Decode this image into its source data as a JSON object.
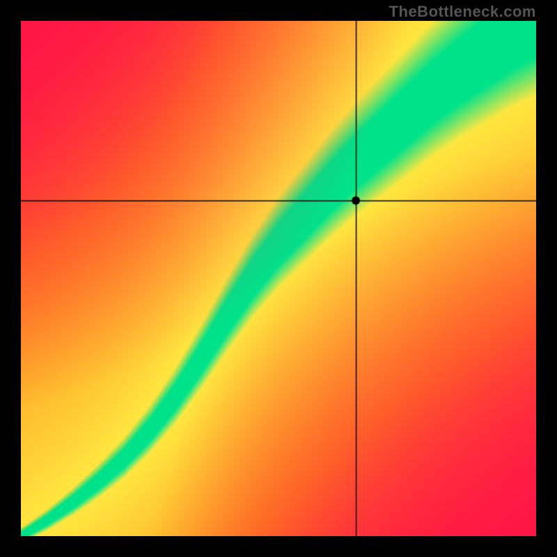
{
  "watermark": "TheBottleneck.com",
  "chart_data": {
    "type": "heatmap",
    "title": "",
    "xlabel": "",
    "ylabel": "",
    "xlim": [
      0,
      1
    ],
    "ylim": [
      0,
      1
    ],
    "crosshair": {
      "x": 0.651,
      "y": 0.651
    },
    "marker": {
      "x": 0.651,
      "y": 0.651
    },
    "green_curve": [
      {
        "x": 0.0,
        "y": 0.0
      },
      {
        "x": 0.05,
        "y": 0.03
      },
      {
        "x": 0.1,
        "y": 0.065
      },
      {
        "x": 0.15,
        "y": 0.105
      },
      {
        "x": 0.2,
        "y": 0.15
      },
      {
        "x": 0.25,
        "y": 0.205
      },
      {
        "x": 0.3,
        "y": 0.27
      },
      {
        "x": 0.35,
        "y": 0.345
      },
      {
        "x": 0.4,
        "y": 0.425
      },
      {
        "x": 0.45,
        "y": 0.5
      },
      {
        "x": 0.5,
        "y": 0.565
      },
      {
        "x": 0.55,
        "y": 0.62
      },
      {
        "x": 0.6,
        "y": 0.675
      },
      {
        "x": 0.65,
        "y": 0.725
      },
      {
        "x": 0.7,
        "y": 0.77
      },
      {
        "x": 0.75,
        "y": 0.815
      },
      {
        "x": 0.8,
        "y": 0.86
      },
      {
        "x": 0.85,
        "y": 0.9
      },
      {
        "x": 0.9,
        "y": 0.935
      },
      {
        "x": 0.95,
        "y": 0.97
      },
      {
        "x": 1.0,
        "y": 1.0
      }
    ],
    "band_width": {
      "inner_green": 0.045,
      "yellow_edge": 0.1
    },
    "colors": {
      "optimal": "#00e28a",
      "warn": "#ffe640",
      "mid": "#ff8c1a",
      "bad": "#ff1744"
    }
  }
}
